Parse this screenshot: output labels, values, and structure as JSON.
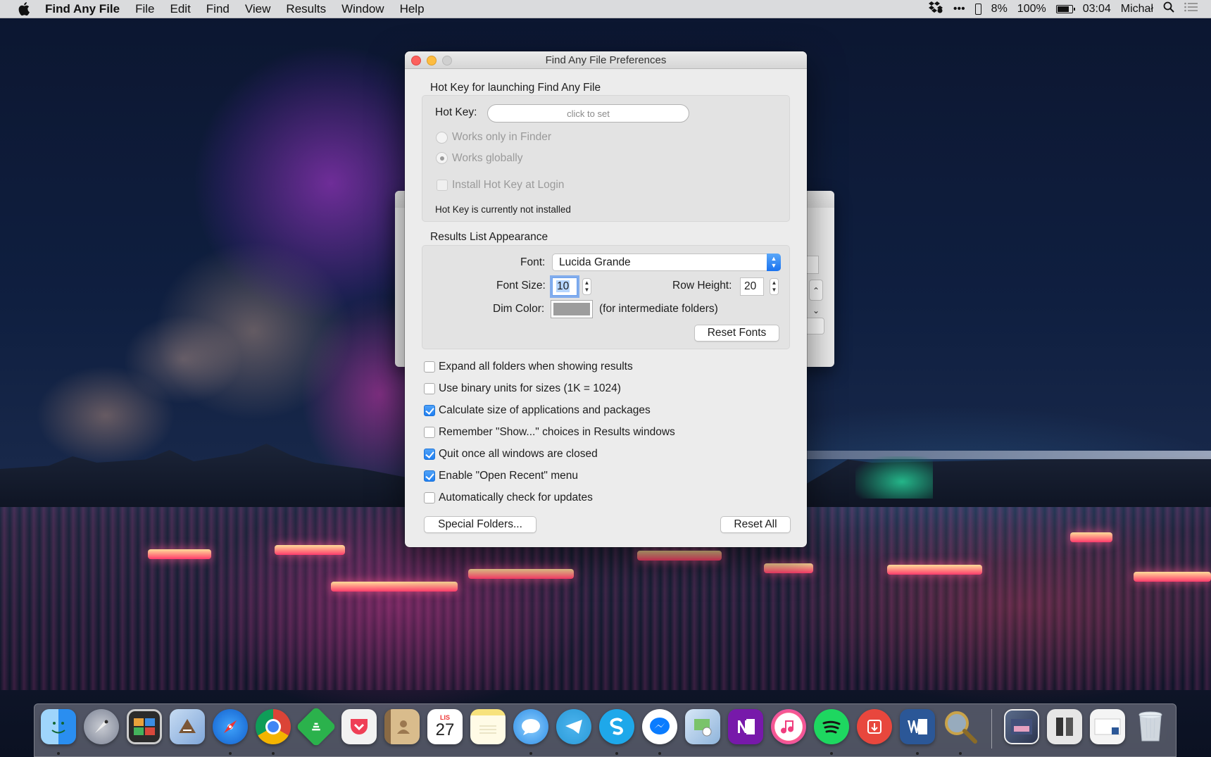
{
  "menubar": {
    "app_name": "Find Any File",
    "items": [
      "File",
      "Edit",
      "Find",
      "View",
      "Results",
      "Window",
      "Help"
    ],
    "status": {
      "ellipsis": "•••",
      "phone_battery": "8%",
      "battery": "100%",
      "time": "03:04",
      "user": "Michał"
    }
  },
  "prefs": {
    "title": "Find Any File Preferences",
    "hotkey_section": {
      "title": "Hot Key for launching Find Any File",
      "hotkey_label": "Hot Key:",
      "hotkey_placeholder": "click to set",
      "radio_finder": "Works only in Finder",
      "radio_global": "Works globally",
      "radio_selected": "global",
      "install_login": "Install Hot Key at Login",
      "install_login_checked": false,
      "status": "Hot Key is currently not installed"
    },
    "appearance_section": {
      "title": "Results List Appearance",
      "font_label": "Font:",
      "font_value": "Lucida Grande",
      "font_size_label": "Font Size:",
      "font_size_value": "10",
      "row_height_label": "Row Height:",
      "row_height_value": "20",
      "dim_color_label": "Dim Color:",
      "dim_color_note": "(for intermediate folders)",
      "dim_color": "#9d9d9d",
      "reset_fonts": "Reset Fonts"
    },
    "options": [
      {
        "label": "Expand all folders when showing results",
        "checked": false
      },
      {
        "label": "Use binary units for sizes (1K = 1024)",
        "checked": false
      },
      {
        "label": "Calculate size of applications and packages",
        "checked": true
      },
      {
        "label": "Remember \"Show...\" choices in Results windows",
        "checked": false
      },
      {
        "label": "Quit once all windows are closed",
        "checked": true
      },
      {
        "label": "Enable \"Open Recent\" menu",
        "checked": true
      },
      {
        "label": "Automatically check for updates",
        "checked": false
      }
    ],
    "special_folders": "Special Folders...",
    "reset_all": "Reset All"
  },
  "dock": {
    "calendar_month": "LIS",
    "calendar_day": "27",
    "apps": [
      "finder",
      "launchpad",
      "photo-booth",
      "mail",
      "safari",
      "chrome",
      "feedly",
      "pocket",
      "contacts",
      "calendar",
      "notes",
      "messages",
      "telegram",
      "skype",
      "messenger",
      "preview",
      "onenote",
      "itunes",
      "spotify",
      "transmit",
      "word",
      "find-any-file",
      "downloads-stack",
      "documents-stack",
      "word-document",
      "trash"
    ]
  },
  "colors": {
    "accent": "#1f7ff2",
    "close": "#fc605c",
    "minimize": "#fdbc40",
    "window_bg": "#ececec"
  }
}
